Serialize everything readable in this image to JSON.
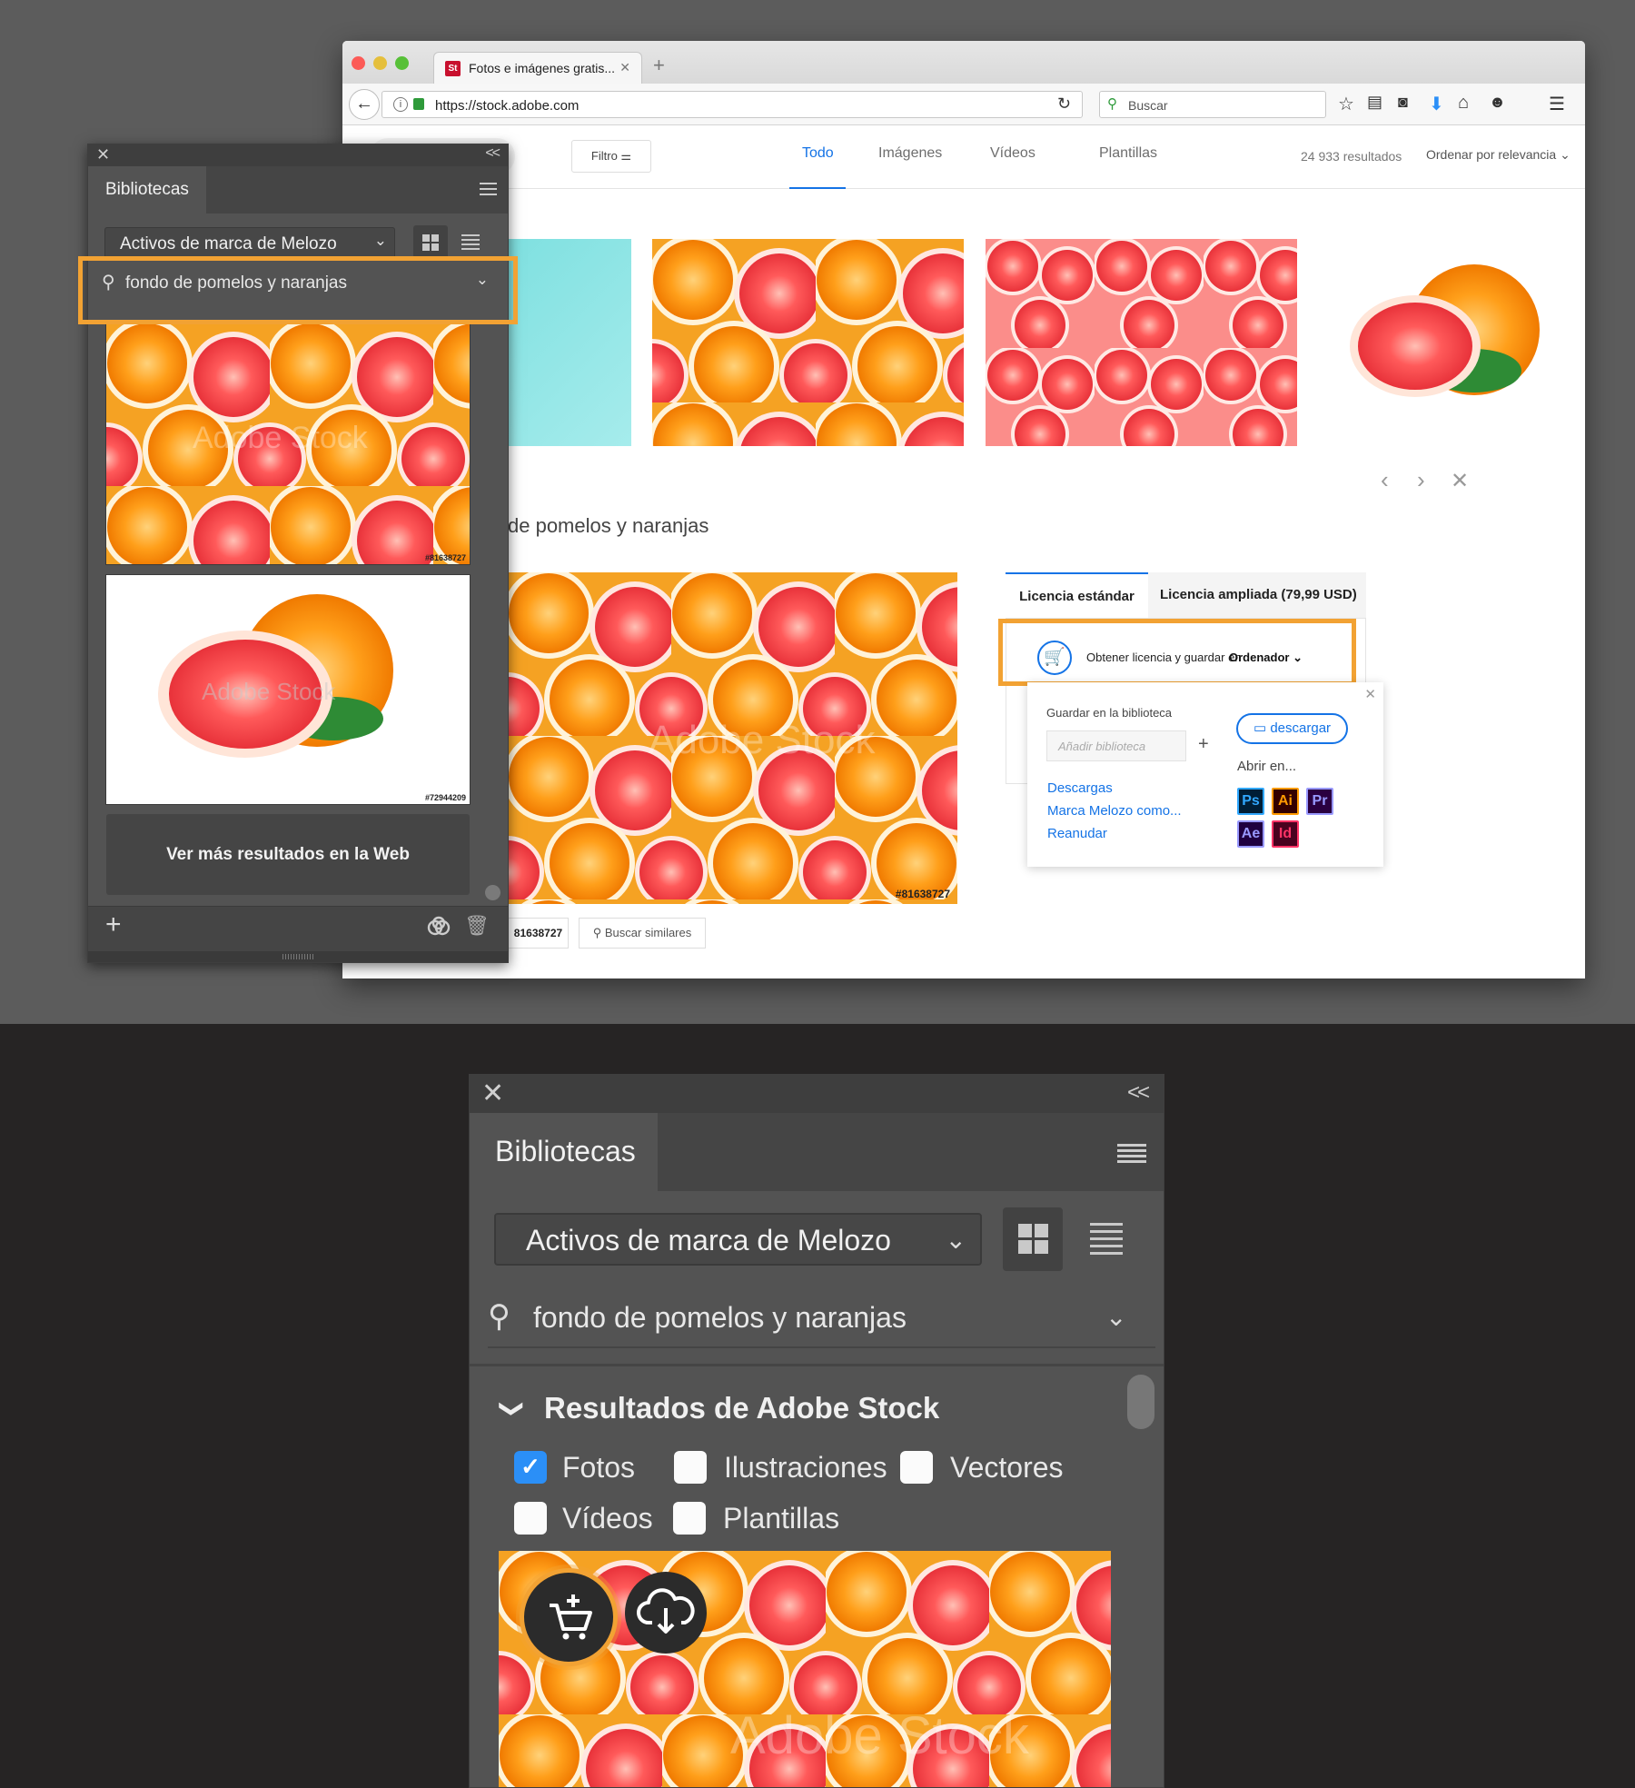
{
  "browser": {
    "tab_title": "Fotos e imágenes gratis...",
    "tab_favicon": "St",
    "url": "https://stock.adobe.com",
    "search_placeholder": "Buscar",
    "toolbar_icons": [
      "star-icon",
      "reading-list-icon",
      "pocket-icon",
      "download-icon",
      "home-icon",
      "chat-icon",
      "hamburger-menu-icon"
    ]
  },
  "site": {
    "filter_label": "Filtro",
    "nav_items": [
      "Todo",
      "Imágenes",
      "Vídeos",
      "Plantillas"
    ],
    "active_nav": "Todo",
    "results_count": "24 933 resultados",
    "sort_label": "Ordenar por relevancia",
    "detail_title": "de pomelos y naranjas",
    "watermark": "Adobe Stock",
    "image_id": "81638727",
    "image_id_tag": "#81638727",
    "similar_label": "Buscar similares",
    "license_tabs": [
      "Licencia estándar",
      "Licencia ampliada (79,99 USD)"
    ],
    "license_action_label": "Obtener licencia y guardar en",
    "license_action_target": "Ordenador",
    "popup": {
      "save_library_label": "Guardar en la biblioteca",
      "library_input_placeholder": "Añadir biblioteca",
      "download_button": "descargar",
      "open_in_label": "Abrir en...",
      "links": [
        "Descargas",
        "Marca Melozo como...",
        "Reanudar"
      ],
      "apps": [
        {
          "abbr": "Ps",
          "color": "#31a8ff",
          "bg": "#001e36"
        },
        {
          "abbr": "Ai",
          "color": "#ff9a00",
          "bg": "#330000"
        },
        {
          "abbr": "Pr",
          "color": "#9999ff",
          "bg": "#2a0040"
        },
        {
          "abbr": "Ae",
          "color": "#9999ff",
          "bg": "#1f0040"
        },
        {
          "abbr": "Id",
          "color": "#ff3366",
          "bg": "#49021f"
        }
      ]
    }
  },
  "small_panel": {
    "tab_label": "Bibliotecas",
    "library_selector": "Activos de marca de Melozo",
    "search_text": "fondo de pomelos y naranjas",
    "image_ids": [
      "#81638727",
      "#72944209"
    ],
    "watermark": "Adobe Stock",
    "more_results": "Ver más resultados en la Web"
  },
  "large_panel": {
    "tab_label": "Bibliotecas",
    "library_selector": "Activos de marca de Melozo",
    "search_text": "fondo de pomelos y naranjas",
    "results_section_title": "Resultados de Adobe Stock",
    "filters": [
      {
        "label": "Fotos",
        "checked": true
      },
      {
        "label": "Ilustraciones",
        "checked": false
      },
      {
        "label": "Vectores",
        "checked": false
      },
      {
        "label": "Vídeos",
        "checked": false
      },
      {
        "label": "Plantillas",
        "checked": false
      }
    ],
    "watermark": "Adobe Stock"
  },
  "colors": {
    "highlight": "#f2a233",
    "accent": "#1473e6",
    "panel_bg": "#535353"
  }
}
